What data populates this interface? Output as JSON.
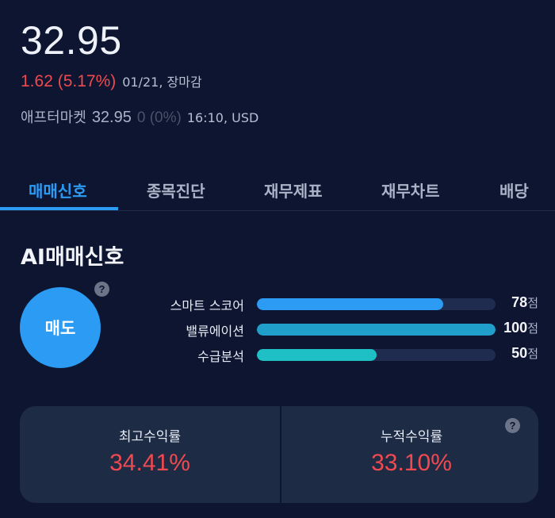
{
  "quote": {
    "price": "32.95",
    "change": "1.62 (5.17%)",
    "date_status": "01/21, 장마감",
    "after_label": "애프터마켓",
    "after_price": "32.95",
    "after_change": "0 (0%)",
    "after_meta": "16:10, USD"
  },
  "tabs": [
    {
      "label": "매매신호",
      "active": true
    },
    {
      "label": "종목진단",
      "active": false
    },
    {
      "label": "재무제표",
      "active": false
    },
    {
      "label": "재무차트",
      "active": false
    },
    {
      "label": "배당",
      "active": false
    }
  ],
  "ai_signal": {
    "title": "AI매매신호",
    "signal": "매도",
    "help_icon": "?",
    "scores": [
      {
        "label": "스마트 스코어",
        "value": 78,
        "value_text": "78",
        "unit": "점",
        "color": "#2b9bf4"
      },
      {
        "label": "밸류에이션",
        "value": 100,
        "value_text": "100",
        "unit": "점",
        "color": "#1f9fc9"
      },
      {
        "label": "수급분석",
        "value": 50,
        "value_text": "50",
        "unit": "점",
        "color": "#1fc0c5"
      }
    ]
  },
  "returns": {
    "max_label": "최고수익률",
    "max_value": "34.41%",
    "cum_label": "누적수익률",
    "cum_value": "33.10%",
    "help_icon": "?"
  },
  "colors": {
    "background": "#0d1530",
    "accent": "#2b9bf4",
    "up": "#ef4a4f",
    "card": "#1e2b45"
  }
}
